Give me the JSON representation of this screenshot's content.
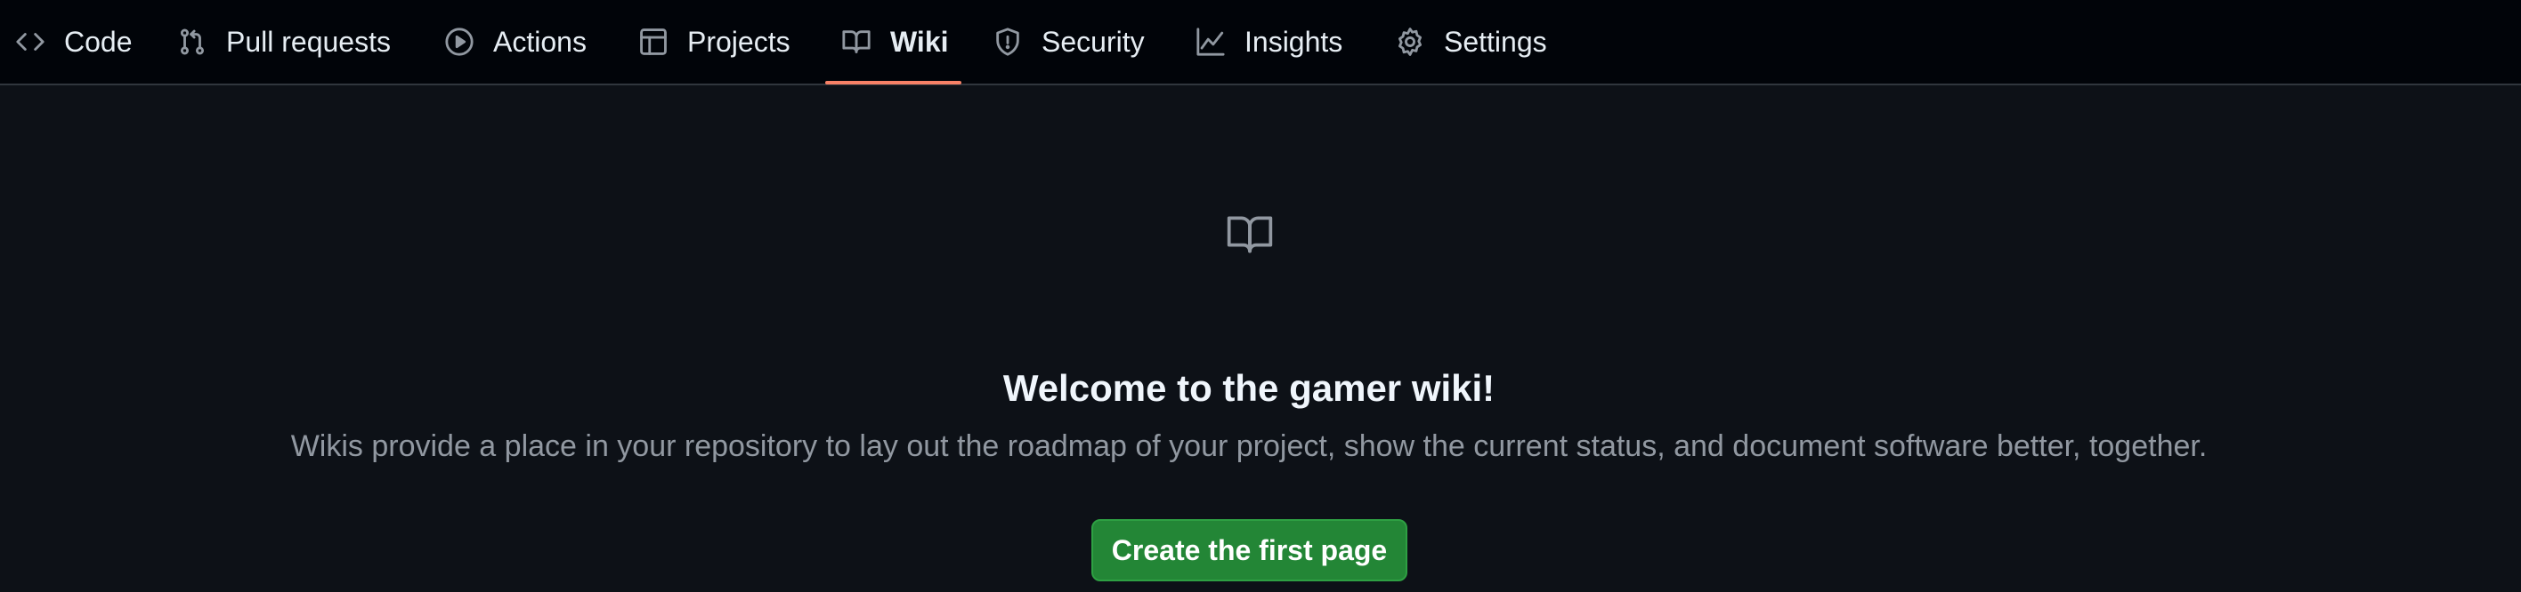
{
  "repo_nav": {
    "items": [
      {
        "label": "Code",
        "icon": "code-icon",
        "selected": false
      },
      {
        "label": "Pull requests",
        "icon": "git-pull-request-icon",
        "selected": false
      },
      {
        "label": "Actions",
        "icon": "play-circle-icon",
        "selected": false
      },
      {
        "label": "Projects",
        "icon": "table-icon",
        "selected": false
      },
      {
        "label": "Wiki",
        "icon": "book-icon",
        "selected": true
      },
      {
        "label": "Security",
        "icon": "shield-icon",
        "selected": false
      },
      {
        "label": "Insights",
        "icon": "graph-icon",
        "selected": false
      },
      {
        "label": "Settings",
        "icon": "gear-icon",
        "selected": false
      }
    ]
  },
  "blankslate": {
    "icon": "book-icon",
    "title": "Welcome to the gamer wiki!",
    "description": "Wikis provide a place in your repository to lay out the roadmap of your project, show the current status, and document software better, together.",
    "button_label": "Create the first page"
  },
  "colors": {
    "page_background": "#0d1117",
    "nav_background": "#010409",
    "selected_underline": "#f78166",
    "primary_button": "#238636",
    "muted_text": "#9198a1",
    "text": "#e6edf3"
  }
}
